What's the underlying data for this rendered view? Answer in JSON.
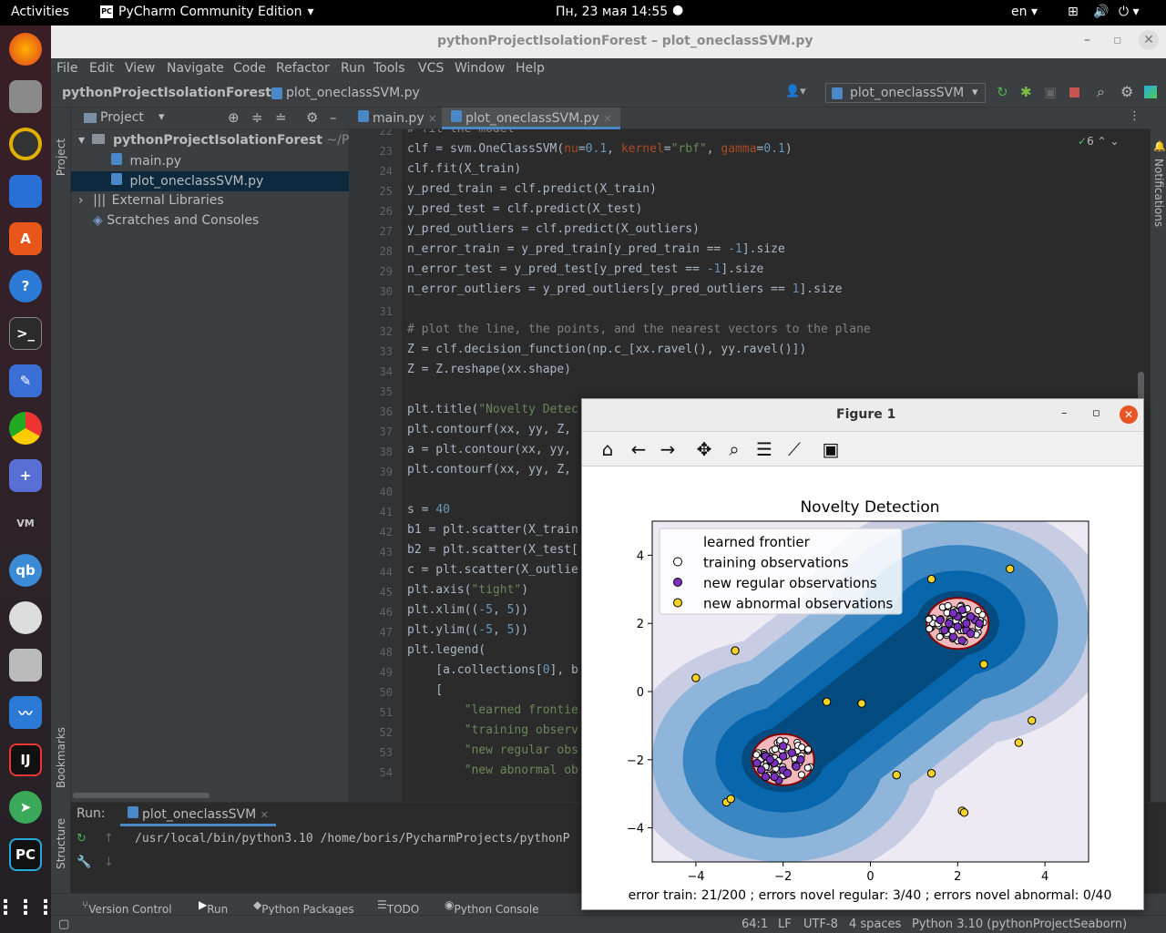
{
  "topbar": {
    "activities": "Activities",
    "app": "PyCharm Community Edition",
    "datetime": "Пн, 23 мая  14:55",
    "lang": "en"
  },
  "window": {
    "title": "pythonProjectIsolationForest – plot_oneclassSVM.py"
  },
  "menu": [
    "File",
    "Edit",
    "View",
    "Navigate",
    "Code",
    "Refactor",
    "Run",
    "Tools",
    "VCS",
    "Window",
    "Help"
  ],
  "nav": {
    "project": "pythonProjectIsolationForest",
    "file": "plot_oneclassSVM.py",
    "run_config": "plot_oneclassSVM"
  },
  "project_panel": {
    "title": "Project",
    "root": "pythonProjectIsolationForest",
    "root_path": "~/Pych",
    "files": [
      "main.py",
      "plot_oneclassSVM.py"
    ],
    "external": "External Libraries",
    "scratches": "Scratches and Consoles"
  },
  "editor": {
    "tabs": [
      "main.py",
      "plot_oneclassSVM.py"
    ],
    "inspections": "6",
    "lines": [
      {
        "n": "22",
        "text": "# fit the model"
      },
      {
        "n": "23",
        "text": "clf = svm.OneClassSVM(nu=0.1, kernel=\"rbf\", gamma=0.1)"
      },
      {
        "n": "24",
        "text": "clf.fit(X_train)"
      },
      {
        "n": "25",
        "text": "y_pred_train = clf.predict(X_train)"
      },
      {
        "n": "26",
        "text": "y_pred_test = clf.predict(X_test)"
      },
      {
        "n": "27",
        "text": "y_pred_outliers = clf.predict(X_outliers)"
      },
      {
        "n": "28",
        "text": "n_error_train = y_pred_train[y_pred_train == -1].size"
      },
      {
        "n": "29",
        "text": "n_error_test = y_pred_test[y_pred_test == -1].size"
      },
      {
        "n": "30",
        "text": "n_error_outliers = y_pred_outliers[y_pred_outliers == 1].size"
      },
      {
        "n": "31",
        "text": ""
      },
      {
        "n": "32",
        "text": "# plot the line, the points, and the nearest vectors to the plane"
      },
      {
        "n": "33",
        "text": "Z = clf.decision_function(np.c_[xx.ravel(), yy.ravel()])"
      },
      {
        "n": "34",
        "text": "Z = Z.reshape(xx.shape)"
      },
      {
        "n": "35",
        "text": ""
      },
      {
        "n": "36",
        "text": "plt.title(\"Novelty Detec"
      },
      {
        "n": "37",
        "text": "plt.contourf(xx, yy, Z,"
      },
      {
        "n": "38",
        "text": "a = plt.contour(xx, yy,"
      },
      {
        "n": "39",
        "text": "plt.contourf(xx, yy, Z,"
      },
      {
        "n": "40",
        "text": ""
      },
      {
        "n": "41",
        "text": "s = 40"
      },
      {
        "n": "42",
        "text": "b1 = plt.scatter(X_train"
      },
      {
        "n": "43",
        "text": "b2 = plt.scatter(X_test["
      },
      {
        "n": "44",
        "text": "c = plt.scatter(X_outlie"
      },
      {
        "n": "45",
        "text": "plt.axis(\"tight\")"
      },
      {
        "n": "46",
        "text": "plt.xlim((-5, 5))"
      },
      {
        "n": "47",
        "text": "plt.ylim((-5, 5))"
      },
      {
        "n": "48",
        "text": "plt.legend("
      },
      {
        "n": "49",
        "text": "    [a.collections[0], b"
      },
      {
        "n": "50",
        "text": "    ["
      },
      {
        "n": "51",
        "text": "        \"learned frontie"
      },
      {
        "n": "52",
        "text": "        \"training observ"
      },
      {
        "n": "53",
        "text": "        \"new regular obs"
      },
      {
        "n": "54",
        "text": "        \"new abnormal ob"
      }
    ]
  },
  "run": {
    "label": "Run:",
    "tab": "plot_oneclassSVM",
    "command": "/usr/local/bin/python3.10 /home/boris/PycharmProjects/pythonP"
  },
  "bottom_tabs": [
    "Version Control",
    "Run",
    "Python Packages",
    "TODO",
    "Python Console"
  ],
  "side_tabs": {
    "project": "Project",
    "bookmarks": "Bookmarks",
    "structure": "Structure",
    "notifications": "Notifications"
  },
  "status": {
    "pos": "64:1",
    "le": "LF",
    "enc": "UTF-8",
    "indent": "4 spaces",
    "interp": "Python 3.10 (pythonProjectSeaborn)"
  },
  "figure": {
    "title": "Figure 1",
    "footer": "error train: 21/200 ; errors novel regular: 3/40 ; errors novel abnormal: 0/40"
  },
  "chart_data": {
    "type": "scatter",
    "title": "Novelty Detection",
    "xlim": [
      -5,
      5
    ],
    "ylim": [
      -5,
      5
    ],
    "xticks": [
      "−4",
      "−2",
      "0",
      "2",
      "4"
    ],
    "yticks": [
      "−4",
      "−2",
      "0",
      "2",
      "4"
    ],
    "legend": [
      "learned frontier",
      "training observations",
      "new regular observations",
      "new abnormal observations"
    ],
    "legend_position": "top-left",
    "colors": {
      "regular": "#7b2fbe",
      "abnormal": "#f5d327",
      "frontier": "#8b0000"
    },
    "abnormal": [
      [
        -4.0,
        0.4
      ],
      [
        -3.1,
        1.2
      ],
      [
        -1.0,
        -0.3
      ],
      [
        -0.2,
        -0.35
      ],
      [
        1.4,
        3.3
      ],
      [
        3.2,
        3.6
      ],
      [
        2.6,
        0.8
      ],
      [
        3.7,
        -0.85
      ],
      [
        3.4,
        -1.5
      ],
      [
        1.4,
        -2.4
      ],
      [
        0.6,
        -2.45
      ],
      [
        2.1,
        -3.5
      ],
      [
        2.15,
        -3.55
      ],
      [
        -3.3,
        -3.25
      ],
      [
        -3.2,
        -3.15
      ]
    ],
    "regular": [
      [
        -2.2,
        -2.1
      ],
      [
        -2.0,
        -2.3
      ],
      [
        -1.8,
        -1.8
      ],
      [
        -2.4,
        -1.9
      ],
      [
        -2.1,
        -2.6
      ],
      [
        -1.7,
        -2.2
      ],
      [
        -2.5,
        -2.3
      ],
      [
        -2.0,
        -1.6
      ],
      [
        -1.9,
        -2.4
      ],
      [
        -2.3,
        -2.0
      ],
      [
        2.0,
        2.2
      ],
      [
        2.2,
        1.8
      ],
      [
        1.8,
        2.0
      ],
      [
        2.4,
        2.1
      ],
      [
        1.9,
        1.6
      ],
      [
        2.1,
        2.4
      ],
      [
        1.7,
        1.8
      ],
      [
        2.3,
        1.7
      ],
      [
        2.0,
        1.9
      ],
      [
        2.5,
        2.0
      ],
      [
        1.6,
        2.1
      ],
      [
        2.2,
        2.0
      ],
      [
        -2.2,
        -2.5
      ],
      [
        -1.6,
        -2.0
      ],
      [
        -2.6,
        -2.1
      ],
      [
        1.9,
        2.3
      ],
      [
        2.1,
        1.5
      ],
      [
        -2.4,
        -2.5
      ],
      [
        -2.0,
        -1.9
      ],
      [
        2.3,
        2.2
      ]
    ]
  }
}
